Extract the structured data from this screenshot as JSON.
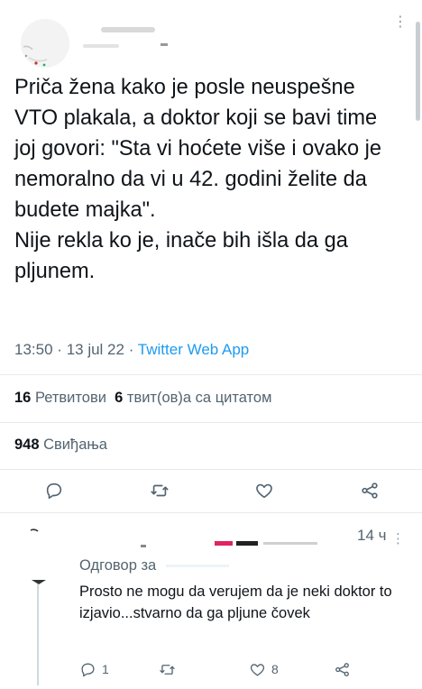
{
  "tweet": {
    "text": "Priča žena kako je posle neuspešne VTO plakala, a doktor koji se bavi time joj govori: \"Sta vi hoćete više i ovako je nemoralno da vi u 42. godini želite da budete majka\".\nNije rekla ko je, inače bih išla da ga pljunem.",
    "time": "13:50",
    "date": "13 jul 22",
    "dot": "·",
    "source": "Twitter Web App"
  },
  "stats": {
    "retweets_count": "16",
    "retweets_label": "Ретвитови",
    "quotes_count": "6",
    "quotes_label": "твит(ов)а са цитатом",
    "likes_count": "948",
    "likes_label": "Свиђања"
  },
  "reply": {
    "time": "14 ч",
    "replying_to": "Одговор за",
    "text": "Prosto ne mogu da verujem da je neki doktor to izjavio...stvarno da ga pljune čovek",
    "reply_count": "1",
    "like_count": "8"
  },
  "icons": [
    "reply-icon",
    "retweet-icon",
    "like-icon",
    "share-icon",
    "more-icon"
  ],
  "colors": {
    "accent": "#1d9bf0",
    "secondary_text": "#536471",
    "divider": "#e7ebee"
  }
}
